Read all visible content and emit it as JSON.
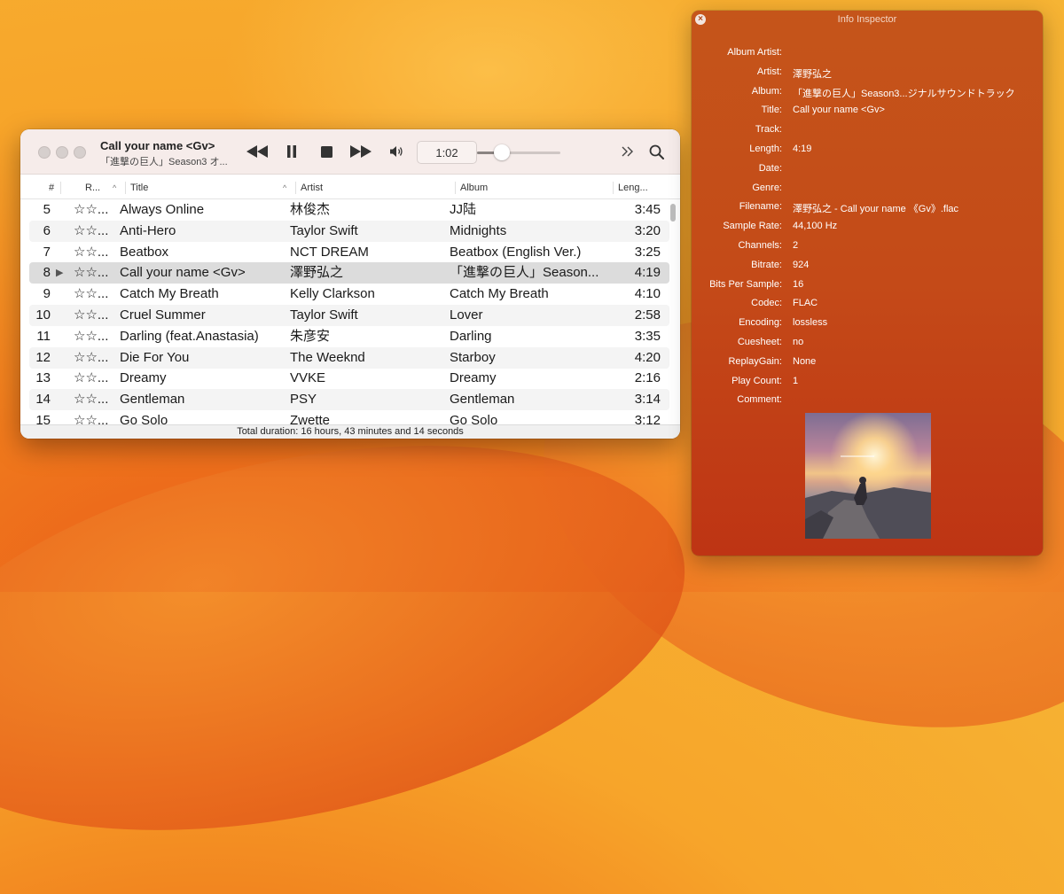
{
  "player": {
    "now_playing_title": "Call your name <Gv>",
    "now_playing_subtitle": "「進撃の巨人」Season3 オ...",
    "time": "1:02",
    "volume_level": 0.3,
    "footer": "Total duration: 16 hours, 43 minutes and 14 seconds",
    "columns": {
      "num": "#",
      "rating": "R...",
      "title": "Title",
      "artist": "Artist",
      "album": "Album",
      "length": "Leng..."
    },
    "tracks": [
      {
        "num": "5",
        "rating": "☆☆...",
        "title": "Always Online",
        "artist": "林俊杰",
        "album": "JJ陆",
        "length": "3:45"
      },
      {
        "num": "6",
        "rating": "☆☆...",
        "title": "Anti-Hero",
        "artist": "Taylor Swift",
        "album": "Midnights",
        "length": "3:20"
      },
      {
        "num": "7",
        "rating": "☆☆...",
        "title": "Beatbox",
        "artist": "NCT DREAM",
        "album": "Beatbox (English Ver.)",
        "length": "3:25"
      },
      {
        "num": "8",
        "rating": "☆☆...",
        "title": "Call your name <Gv>",
        "artist": "澤野弘之",
        "album": "「進撃の巨人」Season...",
        "length": "4:19",
        "playing": "▶"
      },
      {
        "num": "9",
        "rating": "☆☆...",
        "title": "Catch My Breath",
        "artist": "Kelly Clarkson",
        "album": "Catch My Breath",
        "length": "4:10"
      },
      {
        "num": "10",
        "rating": "☆☆...",
        "title": "Cruel Summer",
        "artist": "Taylor Swift",
        "album": "Lover",
        "length": "2:58"
      },
      {
        "num": "11",
        "rating": "☆☆...",
        "title": "Darling (feat.Anastasia)",
        "artist": "朱彦安",
        "album": "Darling",
        "length": "3:35"
      },
      {
        "num": "12",
        "rating": "☆☆...",
        "title": "Die For You",
        "artist": "The Weeknd",
        "album": "Starboy",
        "length": "4:20"
      },
      {
        "num": "13",
        "rating": "☆☆...",
        "title": "Dreamy",
        "artist": "VVKE",
        "album": "Dreamy",
        "length": "2:16"
      },
      {
        "num": "14",
        "rating": "☆☆...",
        "title": "Gentleman",
        "artist": "PSY",
        "album": "Gentleman",
        "length": "3:14"
      },
      {
        "num": "15",
        "rating": "☆☆...",
        "title": "Go Solo",
        "artist": "Zwette",
        "album": "Go Solo",
        "length": "3:12"
      }
    ]
  },
  "inspector": {
    "title": "Info Inspector",
    "close_icon": "×",
    "fields": [
      {
        "label": "Album Artist:",
        "value": ""
      },
      {
        "label": "Artist:",
        "value": "澤野弘之"
      },
      {
        "label": "Album:",
        "value": "「進撃の巨人」Season3...ジナルサウンドトラック"
      },
      {
        "label": "Title:",
        "value": "Call your name <Gv>"
      },
      {
        "label": "Track:",
        "value": ""
      },
      {
        "label": "Length:",
        "value": "4:19"
      },
      {
        "label": "Date:",
        "value": ""
      },
      {
        "label": "Genre:",
        "value": ""
      },
      {
        "label": "Filename:",
        "value": "澤野弘之 - Call your name 《Gv》.flac"
      },
      {
        "label": "Sample Rate:",
        "value": "44,100 Hz"
      },
      {
        "label": "Channels:",
        "value": "2"
      },
      {
        "label": "Bitrate:",
        "value": "924"
      },
      {
        "label": "Bits Per Sample:",
        "value": "16"
      },
      {
        "label": "Codec:",
        "value": "FLAC"
      },
      {
        "label": "Encoding:",
        "value": "lossless"
      },
      {
        "label": "Cuesheet:",
        "value": "no"
      },
      {
        "label": "ReplayGain:",
        "value": "None"
      },
      {
        "label": "Play Count:",
        "value": "1"
      },
      {
        "label": "Comment:",
        "value": ""
      }
    ]
  }
}
